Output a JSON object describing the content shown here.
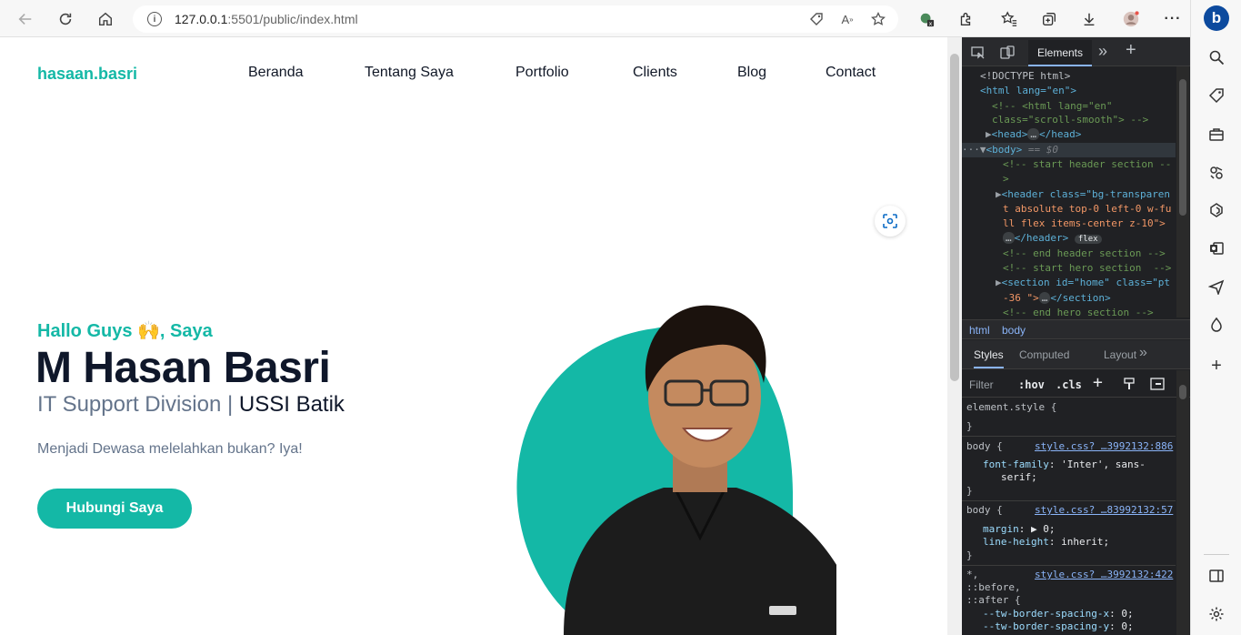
{
  "browser": {
    "url_host": "127.0.0.1",
    "url_path": ":5501/public/index.html"
  },
  "site": {
    "logo": "hasaan.basri",
    "nav": [
      "Beranda",
      "Tentang Saya",
      "Portfolio",
      "Clients",
      "Blog",
      "Contact"
    ],
    "greeting": "Hallo Guys 🙌, Saya",
    "name": "M Hasan Basri",
    "role": "IT Support Division",
    "separator": "|",
    "company": "USSI Batik",
    "tagline": "Menjadi Dewasa melelahkan bukan? Iya!",
    "cta": "Hubungi Saya"
  },
  "devtools": {
    "tab_elements": "Elements",
    "dom_lines": [
      "<!DOCTYPE html>",
      "<html lang=\"en\">",
      "<!-- <html lang=\"en\"",
      "class=\"scroll-smooth\"> -->",
      "<head>",
      "</head>",
      "<body>",
      "== $0",
      "<!-- start header section --",
      ">",
      "<header class=\"bg-transparen",
      "t absolute top-0 left-0 w-fu",
      "ll flex items-center z-10\">",
      "</header>",
      "flex",
      "<!-- end header section -->",
      "<!-- start hero section  -->",
      "<section id=\"home\" class=\"pt",
      "-36 \">",
      "</section>",
      "<!-- end hero section -->"
    ],
    "crumbs": [
      "html",
      "body"
    ],
    "styles_tabs": [
      "Styles",
      "Computed",
      "Layout"
    ],
    "filter_placeholder": "Filter",
    "filter_hov": ":hov",
    "filter_cls": ".cls",
    "rules": {
      "element_style": "element.style {",
      "close": "}",
      "r1_selector": "body {",
      "r1_link": "style.css? …3992132:886",
      "r1_prop": "font-family",
      "r1_val": "'Inter', sans-",
      "r1_val2": "serif;",
      "r2_selector": "body {",
      "r2_link": "style.css? …83992132:57",
      "r2_prop1": "margin",
      "r2_val1": "0;",
      "r2_prop2": "line-height",
      "r2_val2": "inherit;",
      "r3_selector": "*,",
      "r3_link": "style.css? …3992132:422",
      "r3_sel2": "::before,",
      "r3_sel3": "::after {",
      "r3_prop1": "--tw-border-spacing-x",
      "r3_val1": "0;",
      "r3_prop2": "--tw-border-spacing-y",
      "r3_val2": "0;"
    }
  },
  "colors": {
    "accent": "#14b8a6",
    "heading": "#0f172a",
    "muted": "#64748b"
  }
}
